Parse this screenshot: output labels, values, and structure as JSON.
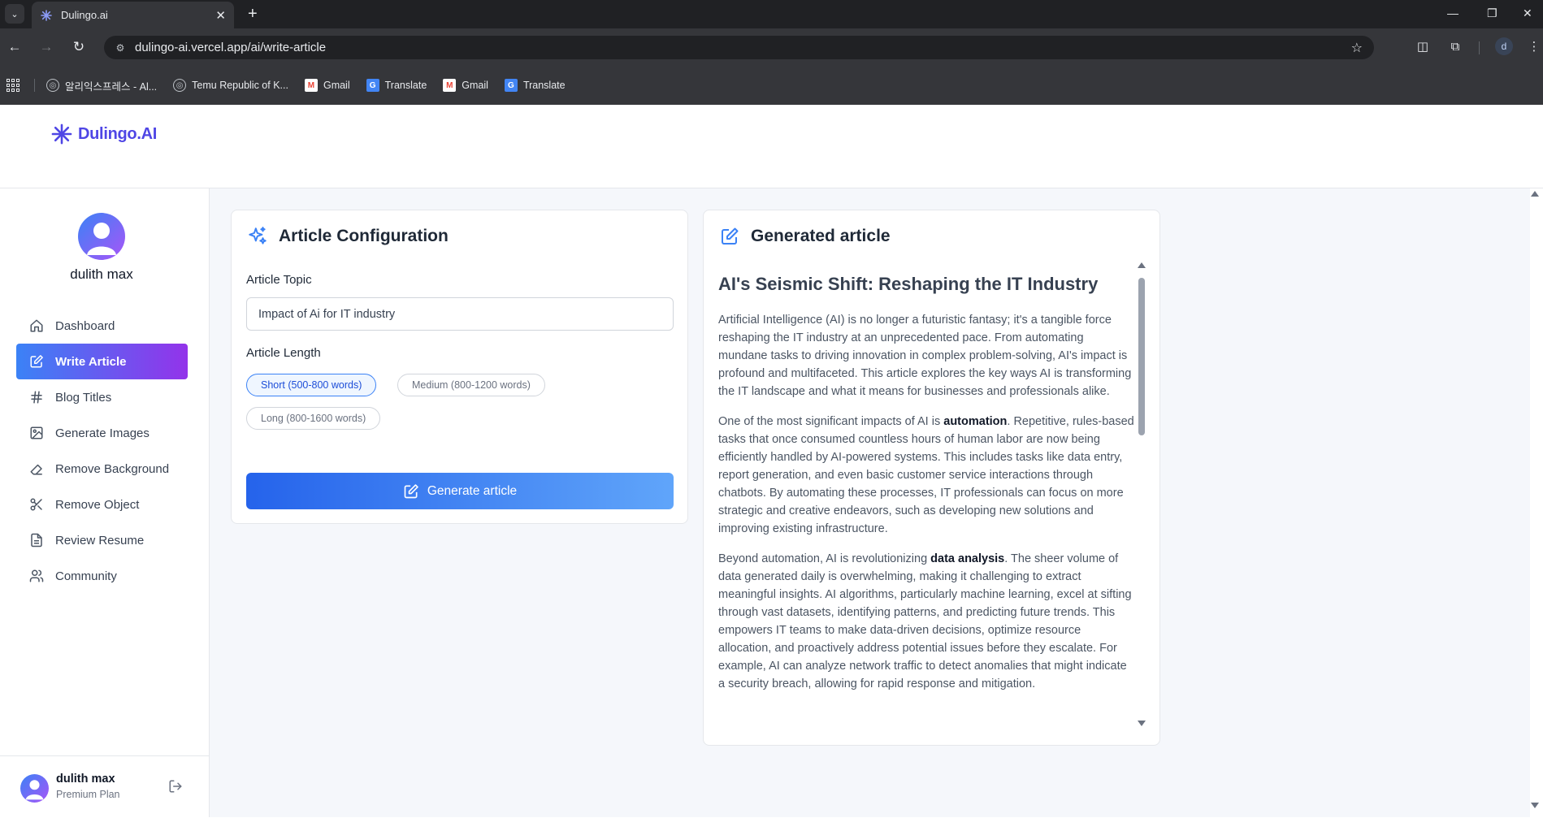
{
  "browser": {
    "tab_title": "Dulingo.ai",
    "url": "dulingo-ai.vercel.app/ai/write-article",
    "profile_initial": "d",
    "bookmarks": [
      {
        "label": "알리익스프레스 - Al...",
        "icon": "globe-icon"
      },
      {
        "label": "Temu Republic of K...",
        "icon": "globe-icon"
      },
      {
        "label": "Gmail",
        "icon": "gmail-icon"
      },
      {
        "label": "Translate",
        "icon": "translate-icon"
      },
      {
        "label": "Gmail",
        "icon": "gmail-icon"
      },
      {
        "label": "Translate",
        "icon": "translate-icon"
      }
    ]
  },
  "app": {
    "logo_text": "Dulingo.AI",
    "brand_color": "#4f46e5"
  },
  "sidebar": {
    "user_name": "dulith max",
    "items": [
      {
        "label": "Dashboard",
        "icon": "home-icon"
      },
      {
        "label": "Write Article",
        "icon": "edit-icon",
        "active": true
      },
      {
        "label": "Blog Titles",
        "icon": "hash-icon"
      },
      {
        "label": "Generate Images",
        "icon": "image-icon"
      },
      {
        "label": "Remove Background",
        "icon": "eraser-icon"
      },
      {
        "label": "Remove Object",
        "icon": "scissors-icon"
      },
      {
        "label": "Review Resume",
        "icon": "file-text-icon"
      },
      {
        "label": "Community",
        "icon": "users-icon"
      }
    ],
    "footer": {
      "name": "dulith max",
      "plan": "Premium Plan"
    }
  },
  "config": {
    "title": "Article Configuration",
    "topic_label": "Article Topic",
    "topic_value": "Impact of Ai for IT industry",
    "length_label": "Article Length",
    "lengths": [
      {
        "label": "Short (500-800 words)",
        "selected": true
      },
      {
        "label": "Medium (800-1200 words)",
        "selected": false
      },
      {
        "label": "Long (800-1600 words)",
        "selected": false
      }
    ],
    "button_label": "Generate article"
  },
  "article": {
    "panel_title": "Generated article",
    "heading": "AI's Seismic Shift: Reshaping the IT Industry",
    "para1": "Artificial Intelligence (AI) is no longer a futuristic fantasy; it's a tangible force reshaping the IT industry at an unprecedented pace. From automating mundane tasks to driving innovation in complex problem-solving, AI's impact is profound and multifaceted. This article explores the key ways AI is transforming the IT landscape and what it means for businesses and professionals alike.",
    "para2_before": "One of the most significant impacts of AI is ",
    "para2_bold": "automation",
    "para2_after": ". Repetitive, rules-based tasks that once consumed countless hours of human labor are now being efficiently handled by AI-powered systems. This includes tasks like data entry, report generation, and even basic customer service interactions through chatbots. By automating these processes, IT professionals can focus on more strategic and creative endeavors, such as developing new solutions and improving existing infrastructure.",
    "para3_before": "Beyond automation, AI is revolutionizing ",
    "para3_bold": "data analysis",
    "para3_after": ". The sheer volume of data generated daily is overwhelming, making it challenging to extract meaningful insights. AI algorithms, particularly machine learning, excel at sifting through vast datasets, identifying patterns, and predicting future trends. This empowers IT teams to make data-driven decisions, optimize resource allocation, and proactively address potential issues before they escalate. For example, AI can analyze network traffic to detect anomalies that might indicate a security breach, allowing for rapid response and mitigation."
  }
}
